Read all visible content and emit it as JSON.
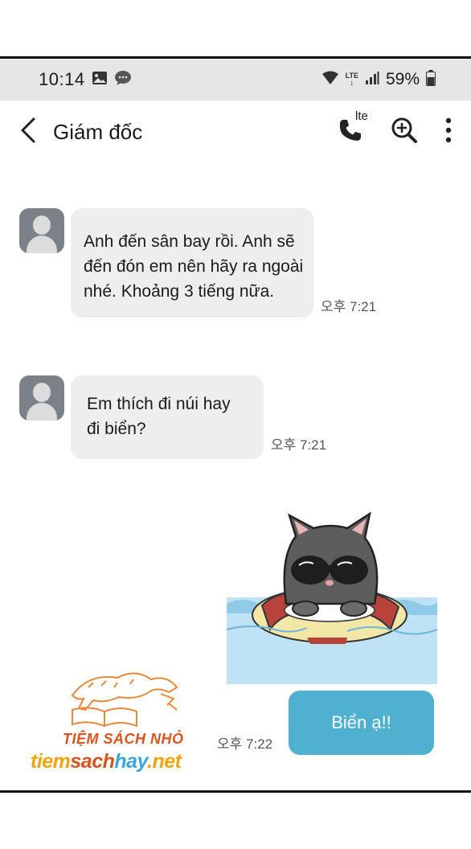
{
  "status_bar": {
    "time": "10:14",
    "network": "LTE",
    "battery": "59%",
    "icons": [
      "gallery-icon",
      "chat-bubble-icon",
      "wifi-icon",
      "lte-icon",
      "signal-icon",
      "battery-icon"
    ]
  },
  "header": {
    "contact_name": "Giám đốc",
    "call_badge": "lte",
    "icons": [
      "back-arrow-icon",
      "phone-icon",
      "zoom-in-icon",
      "more-vert-icon"
    ]
  },
  "messages": [
    {
      "direction": "incoming",
      "lines": [
        "Anh đến sân bay rồi. Anh sẽ",
        "đến đón em nên hãy ra ngoài",
        "nhé. Khoảng 3 tiếng nữa."
      ],
      "time": "오후 7:21"
    },
    {
      "direction": "incoming",
      "lines": [
        "Em thích đi núi hay",
        "đi biển?"
      ],
      "time": "오후 7:21"
    },
    {
      "direction": "outgoing",
      "type": "sticker",
      "sticker": "gray-cat-with-sunglasses-in-swim-ring"
    },
    {
      "direction": "outgoing",
      "text": "Biển ạ!!",
      "time": "오후 7:22"
    }
  ],
  "watermark": {
    "line1": "TIỆM SÁCH NHỎ",
    "line2_parts": [
      "tiem",
      "sach",
      "hay",
      ".net"
    ]
  },
  "colors": {
    "status_bar_bg": "#e6e6e6",
    "incoming_bubble": "#eeeeee",
    "outgoing_bubble": "#4fb0cf",
    "avatar_bg": "#7a8288",
    "water": "#bfe3f4"
  }
}
